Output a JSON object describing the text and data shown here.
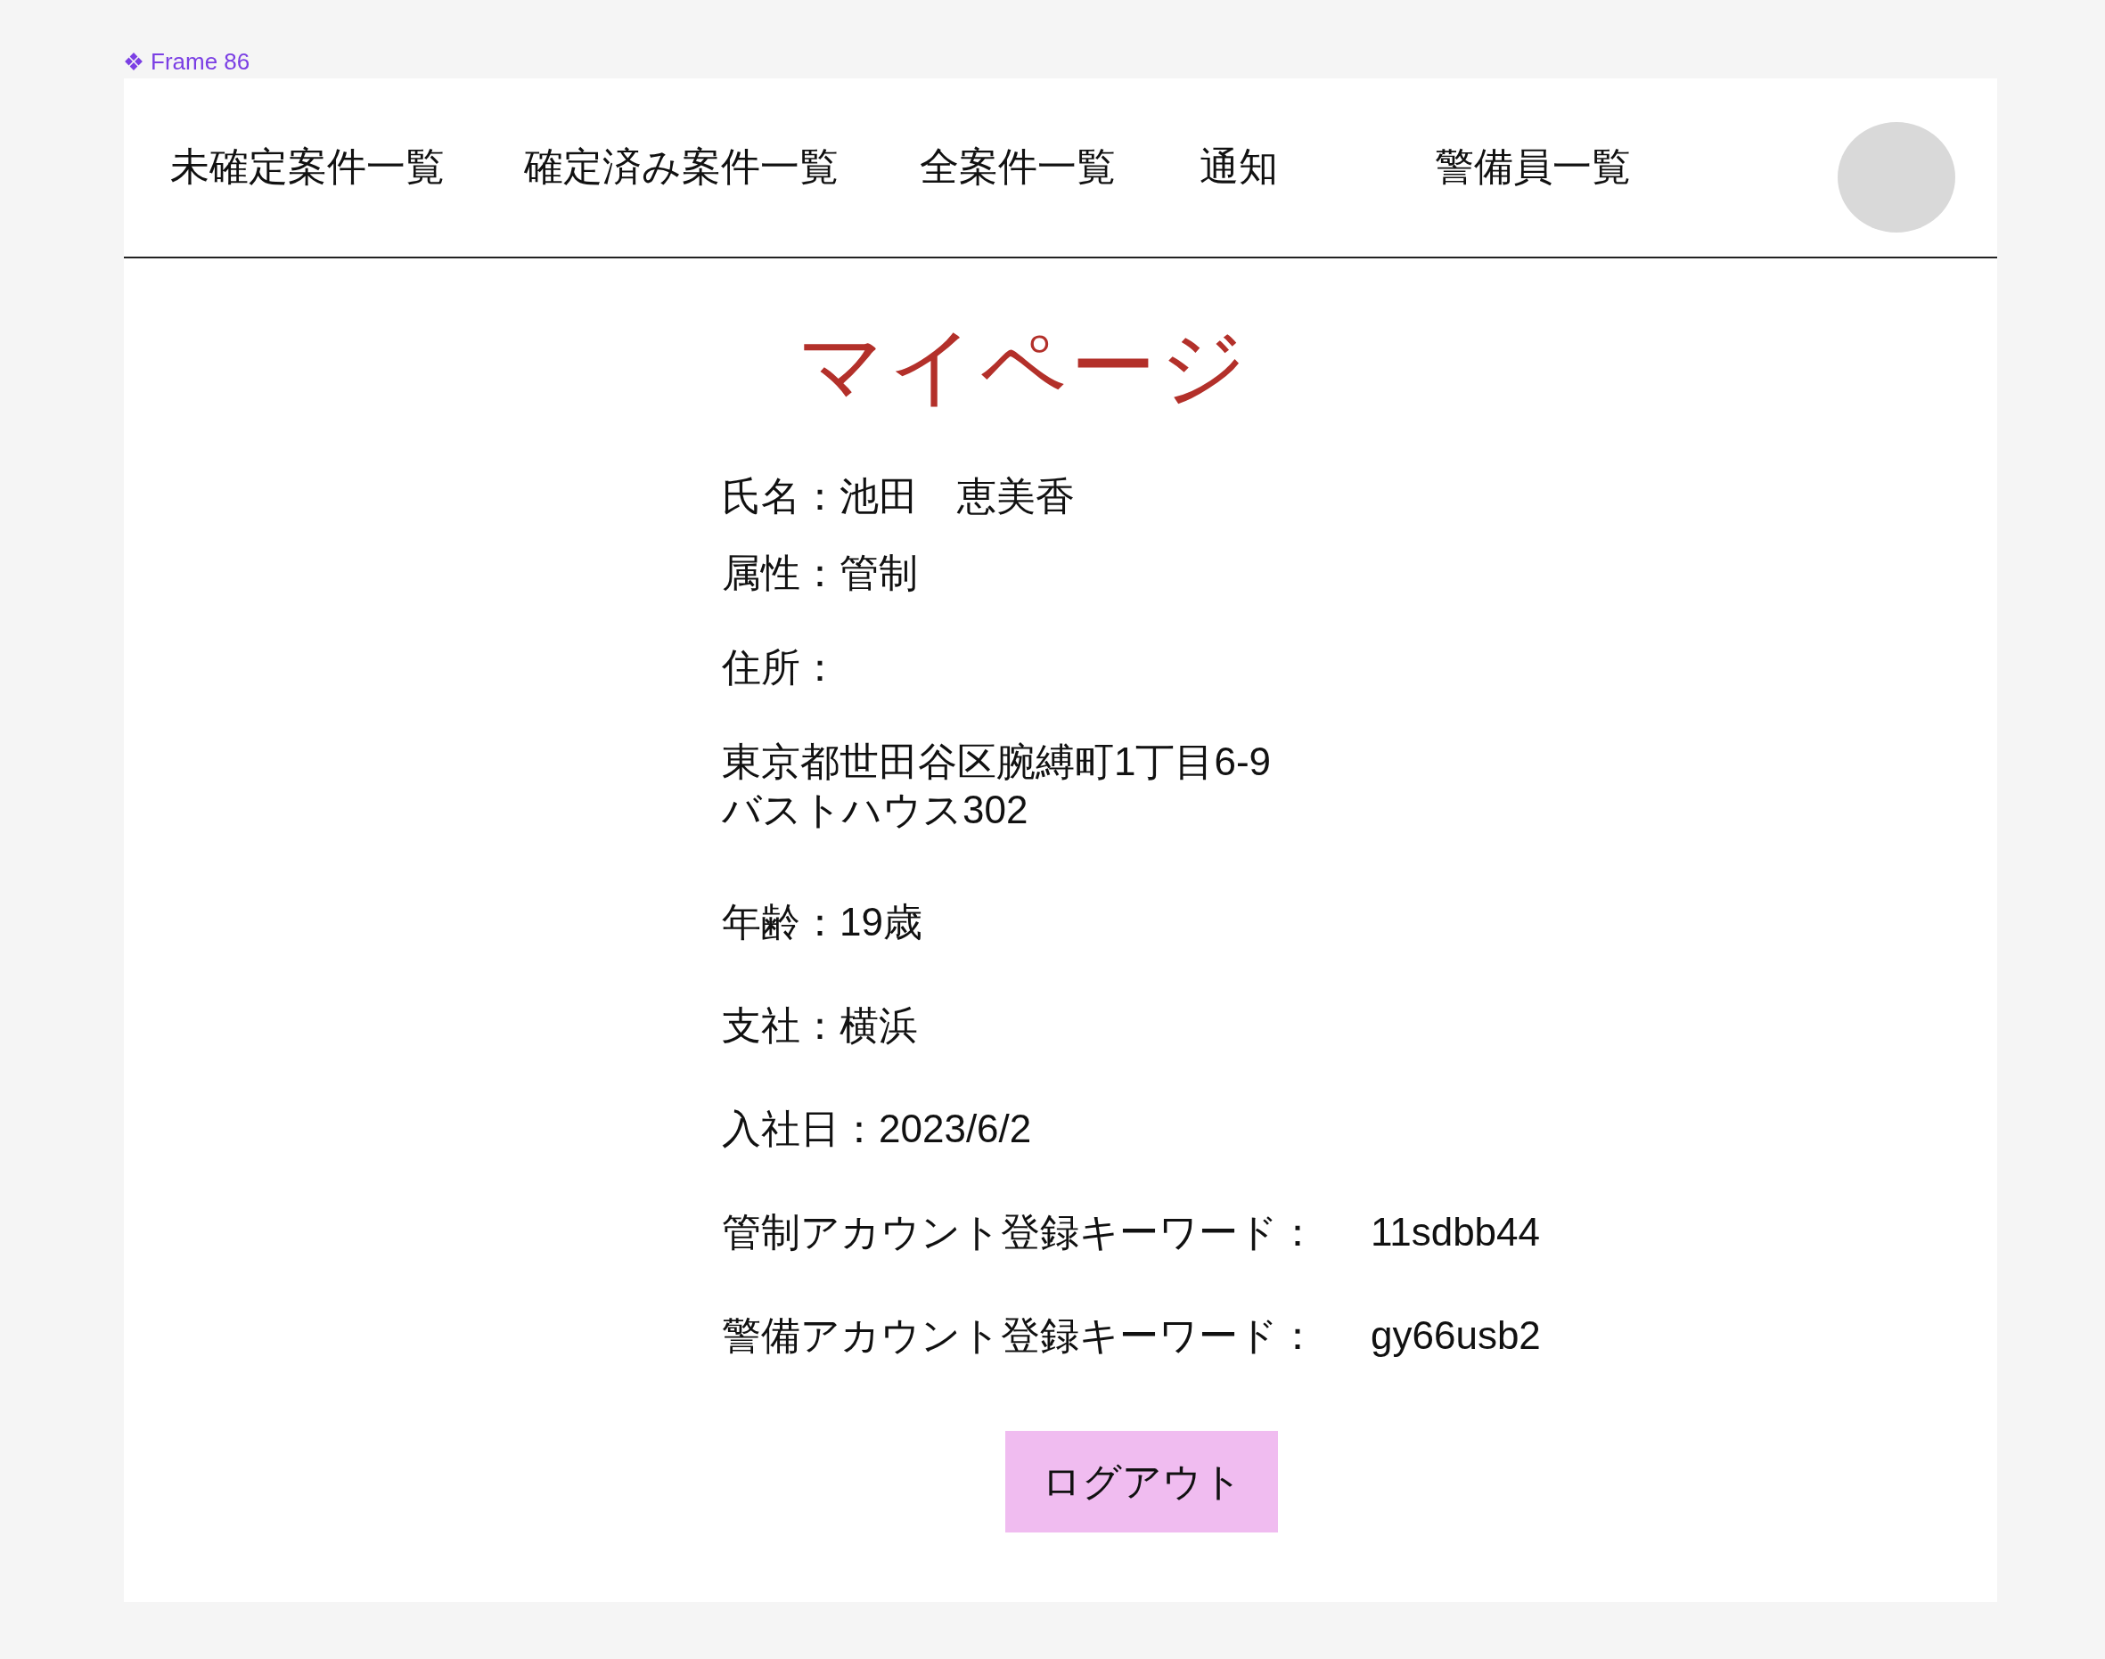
{
  "frame_label": "Frame 86",
  "nav": {
    "items": [
      "未確定案件一覧",
      "確定済み案件一覧",
      "全案件一覧",
      "通知",
      "警備員一覧"
    ]
  },
  "title": "マイページ",
  "profile": [
    {
      "kind": "line",
      "text": "氏名：池田　恵美香"
    },
    {
      "kind": "line",
      "text": "属性：管制"
    },
    {
      "kind": "line",
      "text": "住所："
    },
    {
      "kind": "address",
      "lines": [
        "東京都世田谷区腕縛町1丁目6-9",
        "バストハウス302"
      ]
    },
    {
      "kind": "line",
      "text": "年齢：19歳"
    },
    {
      "kind": "line",
      "text": "支社：横浜"
    },
    {
      "kind": "line",
      "text": "入社日：2023/6/2"
    },
    {
      "kind": "keyword",
      "label": "管制アカウント登録キーワード：",
      "value": "11sdbb44"
    },
    {
      "kind": "keyword",
      "label": "警備アカウント登録キーワード：",
      "value": "gy66usb2"
    }
  ],
  "logout_button": "ログアウト"
}
